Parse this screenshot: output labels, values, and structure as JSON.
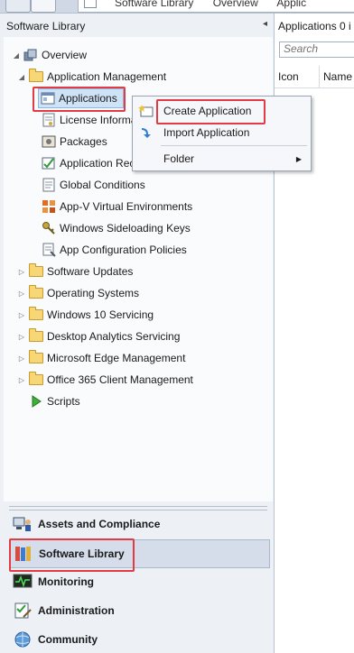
{
  "topbar": {
    "breadcrumbs": [
      "Software Library",
      "Overview",
      "Applic"
    ]
  },
  "left_pane": {
    "title": "Software Library",
    "collapse_glyph": "◂"
  },
  "tree": {
    "overview": "Overview",
    "app_management": "Application Management",
    "items": {
      "applications": "Applications",
      "license_information": "License Informa",
      "packages": "Packages",
      "application_requests": "Application Rec",
      "global_conditions": "Global Conditions",
      "appv_environments": "App-V Virtual Environments",
      "sideloading_keys": "Windows Sideloading Keys",
      "app_config_policies": "App Configuration Policies"
    },
    "folders": {
      "software_updates": "Software Updates",
      "operating_systems": "Operating Systems",
      "windows10_servicing": "Windows 10 Servicing",
      "desktop_analytics": "Desktop Analytics Servicing",
      "edge_management": "Microsoft Edge Management",
      "office365_management": "Office 365 Client Management"
    },
    "scripts": "Scripts"
  },
  "context_menu": {
    "create_application": "Create Application",
    "import_application": "Import Application",
    "folder": "Folder"
  },
  "workspaces": {
    "assets": "Assets and Compliance",
    "software_library": "Software Library",
    "monitoring": "Monitoring",
    "administration": "Administration",
    "community": "Community"
  },
  "right_pane": {
    "title": "Applications 0 i",
    "search_placeholder": "Search",
    "columns": [
      "Icon",
      "Name"
    ]
  },
  "colors": {
    "highlight_red": "#e33b44",
    "selection_blue": "#cfe3f7",
    "folder_yellow": "#f6d675"
  }
}
